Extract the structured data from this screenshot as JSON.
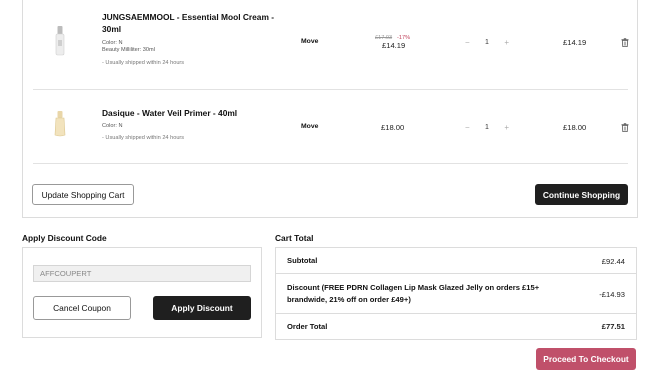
{
  "cart": {
    "items": [
      {
        "name_line1": "JUNGSAEMMOOL - Essential Mool Cream -",
        "name_line2": "30ml",
        "color": "Color: N",
        "size": "Beauty Milliliter: 30ml",
        "shipping": "- Usually shipped within 24 hours",
        "move_label": "Move",
        "old_price": "£17.03",
        "discount": "-17%",
        "price": "£14.19",
        "qty": "1",
        "subtotal": "£14.19"
      },
      {
        "name_line1": "Dasique - Water Veil Primer - 40ml",
        "color": "Color: N",
        "shipping": "- Usually shipped within 24 hours",
        "move_label": "Move",
        "price": "£18.00",
        "qty": "1",
        "subtotal": "£18.00"
      }
    ],
    "qty_minus": "−",
    "qty_plus": "+",
    "update_label": "Update Shopping Cart",
    "continue_label": "Continue Shopping"
  },
  "discount": {
    "title": "Apply Discount Code",
    "code_value": "AFFCOUPERT",
    "cancel_label": "Cancel Coupon",
    "apply_label": "Apply Discount"
  },
  "totals": {
    "title": "Cart Total",
    "subtotal_label": "Subtotal",
    "subtotal_value": "£92.44",
    "discount_label_line1": "Discount (FREE PDRN Collagen Lip Mask Glazed Jelly on orders £15+",
    "discount_label_line2": "brandwide, 21% off on order £49+)",
    "discount_value": "-£14.93",
    "order_total_label": "Order Total",
    "order_total_value": "£77.51"
  },
  "checkout_label": "Proceed To Checkout",
  "icons": {
    "trash": "trash-icon"
  },
  "colors": {
    "accent": "#c0506a",
    "dark": "#1f1f1f",
    "sale": "#c0405a"
  }
}
